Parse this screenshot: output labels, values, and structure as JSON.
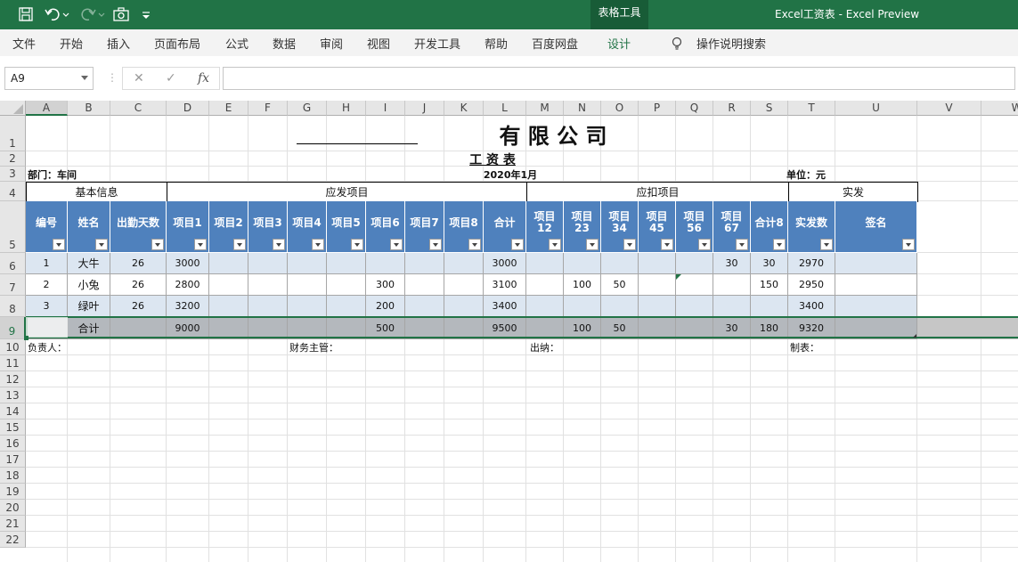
{
  "app": {
    "title": "Excel工资表  -  Excel Preview",
    "tool_tab": "表格工具"
  },
  "quick_access": {
    "save_icon": "save-icon",
    "undo_icon": "undo-icon",
    "redo_icon": "redo-icon",
    "camera_icon": "camera-icon",
    "customize_icon": "customize-icon"
  },
  "ribbon": {
    "tabs": [
      "文件",
      "开始",
      "插入",
      "页面布局",
      "公式",
      "数据",
      "审阅",
      "视图",
      "开发工具",
      "帮助",
      "百度网盘",
      "设计"
    ],
    "active_tab": "设计",
    "search_label": "操作说明搜索"
  },
  "formula_bar": {
    "name_box": "A9",
    "cancel": "✕",
    "enter": "✓",
    "fx": "fx",
    "value": ""
  },
  "columns": [
    "A",
    "B",
    "C",
    "D",
    "E",
    "F",
    "G",
    "H",
    "I",
    "J",
    "K",
    "L",
    "M",
    "N",
    "O",
    "P",
    "Q",
    "R",
    "S",
    "T",
    "U",
    "V",
    "W"
  ],
  "rows": [
    "1",
    "2",
    "3",
    "4",
    "5",
    "6",
    "7",
    "8",
    "9",
    "10",
    "11",
    "12",
    "13",
    "14",
    "15",
    "16",
    "17",
    "18",
    "19",
    "20",
    "21",
    "22"
  ],
  "sheet": {
    "title_blank": "____________",
    "title": "有 限 公 司",
    "subtitle": "工  资  表",
    "dept_label": "部门：车间",
    "date": "2020年1月",
    "unit": "单位：元",
    "groups": [
      "基本信息",
      "应发项目",
      "应扣项目",
      "实发"
    ],
    "headers": [
      "编号",
      "姓名",
      "出勤天数",
      "项目1",
      "项目2",
      "项目3",
      "项目4",
      "项目5",
      "项目6",
      "项目7",
      "项目8",
      "合计",
      "项目12",
      "项目23",
      "项目34",
      "项目45",
      "项目56",
      "项目67",
      "合计8",
      "实发数",
      "签名"
    ],
    "data_rows": [
      [
        "1",
        "大牛",
        "26",
        "3000",
        "",
        "",
        "",
        "",
        "",
        "",
        "",
        "3000",
        "",
        "",
        "",
        "",
        "",
        "30",
        "30",
        "2970",
        ""
      ],
      [
        "2",
        "小兔",
        "26",
        "2800",
        "",
        "",
        "",
        "",
        "300",
        "",
        "",
        "3100",
        "",
        "100",
        "50",
        "",
        "",
        "",
        "150",
        "2950",
        ""
      ],
      [
        "3",
        "绿叶",
        "26",
        "3200",
        "",
        "",
        "",
        "",
        "200",
        "",
        "",
        "3400",
        "",
        "",
        "",
        "",
        "",
        "",
        "",
        "3400",
        ""
      ]
    ],
    "total_row": [
      "",
      "合计",
      "",
      "9000",
      "",
      "",
      "",
      "",
      "500",
      "",
      "",
      "9500",
      "",
      "100",
      "50",
      "",
      "",
      "30",
      "180",
      "9320",
      ""
    ],
    "footer": {
      "responsible": "负责人：",
      "finance": "财务主管：",
      "cashier": "出纳：",
      "maker": "制表："
    }
  }
}
